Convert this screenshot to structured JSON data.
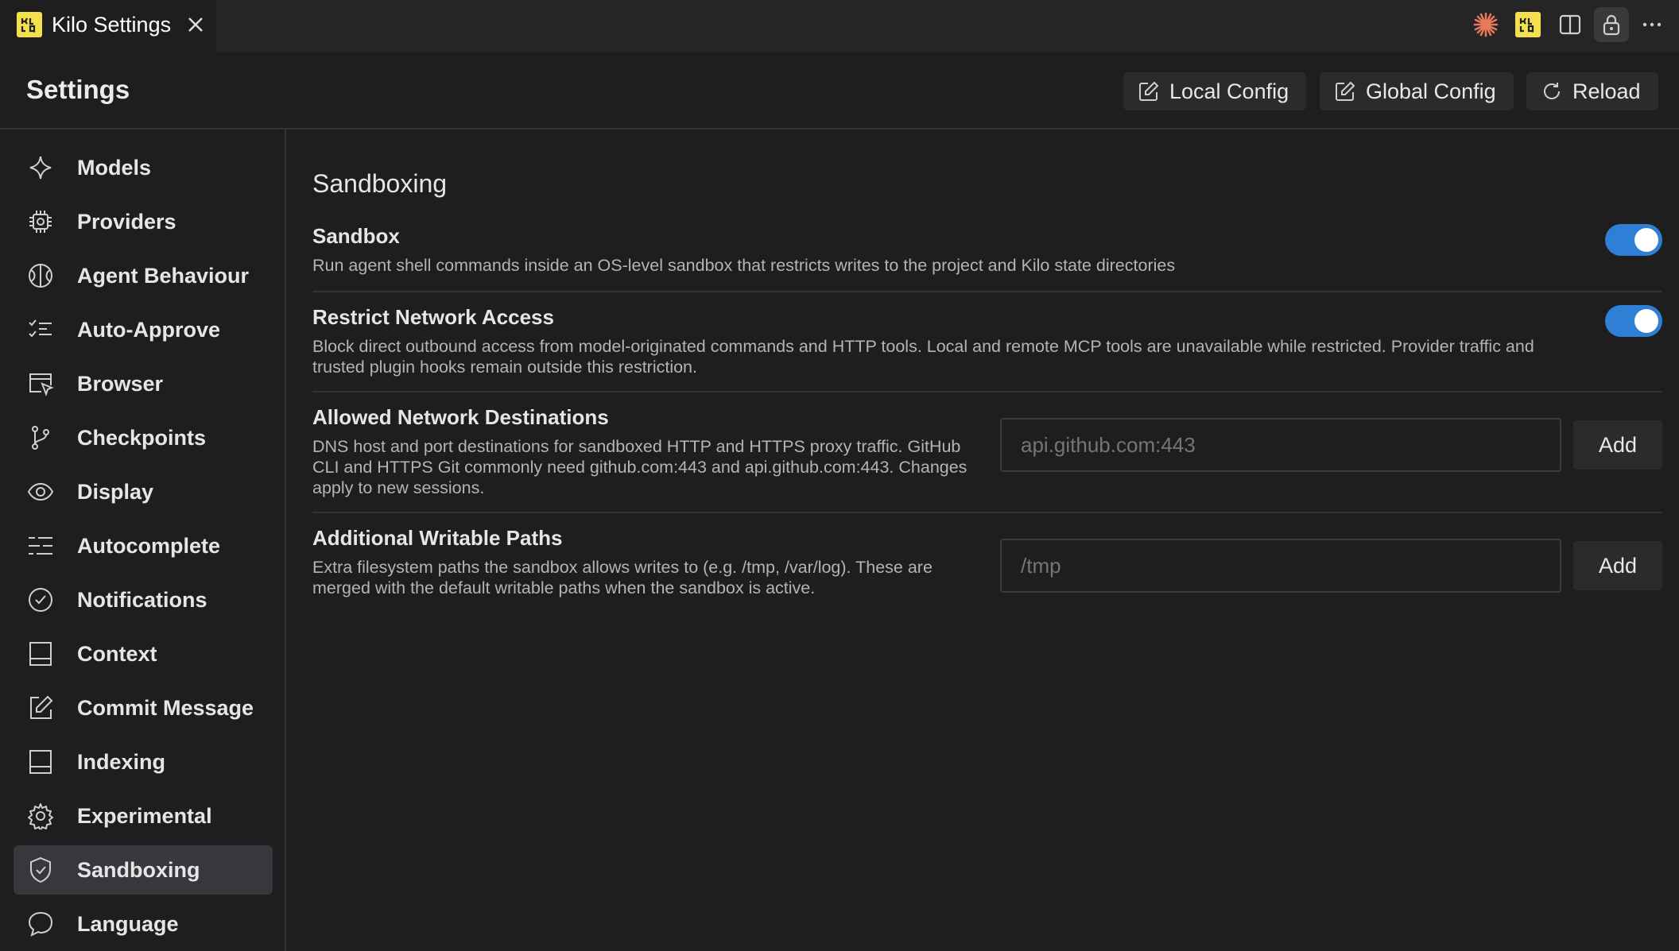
{
  "tab": {
    "label": "Kilo Settings"
  },
  "header": {
    "title": "Settings",
    "local_config": "Local Config",
    "global_config": "Global Config",
    "reload": "Reload"
  },
  "sidebar": {
    "items": [
      {
        "label": "Models",
        "icon": "sparkle-icon"
      },
      {
        "label": "Providers",
        "icon": "chip-icon"
      },
      {
        "label": "Agent Behaviour",
        "icon": "agent-icon"
      },
      {
        "label": "Auto-Approve",
        "icon": "checklist-icon"
      },
      {
        "label": "Browser",
        "icon": "browser-icon"
      },
      {
        "label": "Checkpoints",
        "icon": "git-branch-icon"
      },
      {
        "label": "Display",
        "icon": "eye-icon"
      },
      {
        "label": "Autocomplete",
        "icon": "list-icon"
      },
      {
        "label": "Notifications",
        "icon": "check-circle-icon"
      },
      {
        "label": "Context",
        "icon": "panel-icon"
      },
      {
        "label": "Commit Message",
        "icon": "edit-icon"
      },
      {
        "label": "Indexing",
        "icon": "panel-icon"
      },
      {
        "label": "Experimental",
        "icon": "gear-icon"
      },
      {
        "label": "Sandboxing",
        "icon": "shield-icon",
        "active": true
      },
      {
        "label": "Language",
        "icon": "chat-bubble-icon"
      }
    ]
  },
  "main": {
    "section_title": "Sandboxing",
    "sandbox": {
      "title": "Sandbox",
      "description": "Run agent shell commands inside an OS-level sandbox that restricts writes to the project and Kilo state directories",
      "enabled": true
    },
    "network": {
      "title": "Restrict Network Access",
      "description": "Block direct outbound access from model-originated commands and HTTP tools. Local and remote MCP tools are unavailable while restricted. Provider traffic and trusted plugin hooks remain outside this restriction.",
      "enabled": true
    },
    "destinations": {
      "title": "Allowed Network Destinations",
      "description": "DNS host and port destinations for sandboxed HTTP and HTTPS proxy traffic. GitHub CLI and HTTPS Git commonly need github.com:443 and api.github.com:443. Changes apply to new sessions.",
      "placeholder": "api.github.com:443",
      "add_label": "Add"
    },
    "writable": {
      "title": "Additional Writable Paths",
      "description": "Extra filesystem paths the sandbox allows writes to (e.g. /tmp, /var/log). These are merged with the default writable paths when the sandbox is active.",
      "placeholder": "/tmp",
      "add_label": "Add"
    }
  },
  "colors": {
    "background": "#1e1e1e",
    "accent": "#2f7fd6",
    "active_item": "#37373d",
    "logo": "#f4e04d"
  }
}
